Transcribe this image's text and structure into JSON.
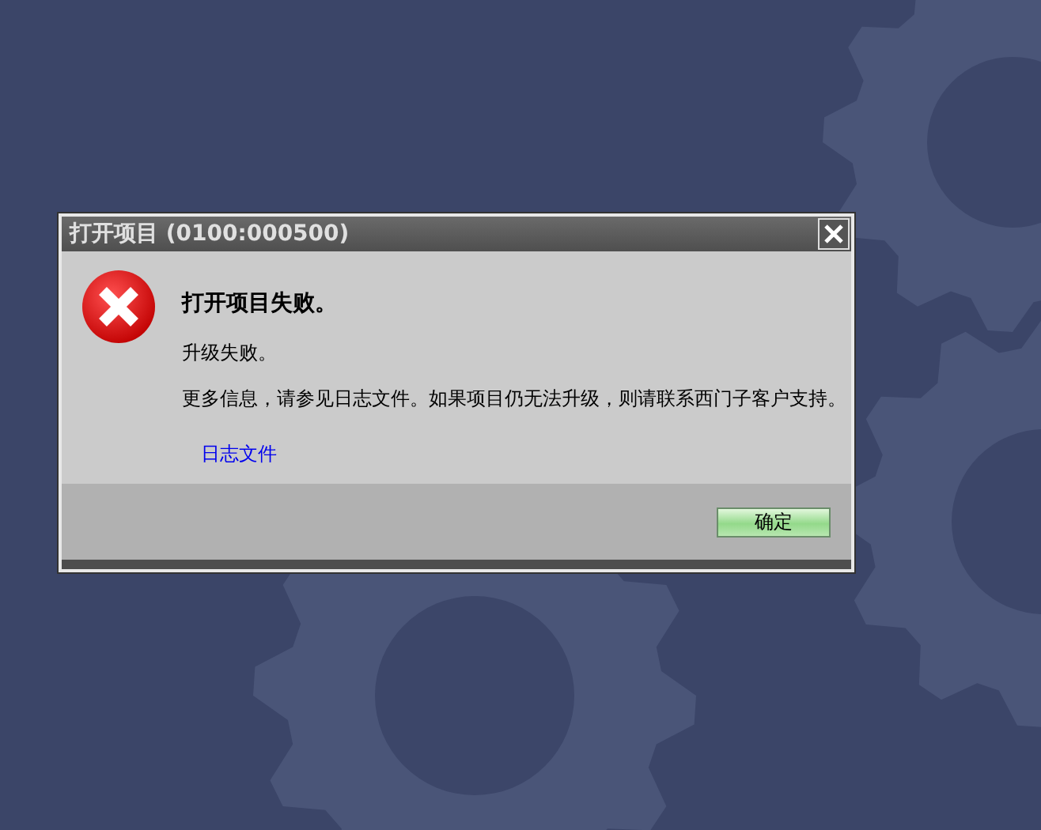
{
  "dialog": {
    "title": "打开项目 (0100:000500)",
    "heading": "打开项目失败。",
    "detail": "升级失败。",
    "more_info": "更多信息，请参见日志文件。如果项目仍无法升级，则请联系西门子客户支持。",
    "link": "日志文件",
    "buttons": [
      "确定"
    ]
  }
}
